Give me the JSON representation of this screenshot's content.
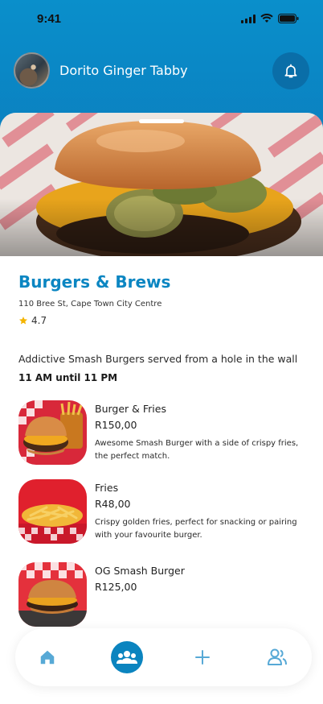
{
  "status_bar": {
    "time": "9:41"
  },
  "user": {
    "name": "Dorito Ginger Tabby"
  },
  "restaurant": {
    "name": "Burgers & Brews",
    "address": "110 Bree St, Cape Town City Centre",
    "rating": "4.7",
    "description": "Addictive Smash Burgers served from a hole in the wall",
    "hours": "11 AM until 11 PM"
  },
  "menu": [
    {
      "name": "Burger & Fries",
      "price": "R150,00",
      "description": "Awesome Smash Burger with a side of crispy fries, the perfect match."
    },
    {
      "name": "Fries",
      "price": "R48,00",
      "description": "Crispy golden fries, perfect for snacking or pairing with your favourite burger."
    },
    {
      "name": "OG Smash Burger",
      "price": "R125,00",
      "description": ""
    }
  ],
  "nav": {
    "items": [
      "home-icon",
      "group-icon",
      "plus-icon",
      "users-icon"
    ],
    "active": "group-icon"
  },
  "colors": {
    "brand": "#0b86c2",
    "header": "#0a8fcb",
    "star": "#f4b400"
  }
}
